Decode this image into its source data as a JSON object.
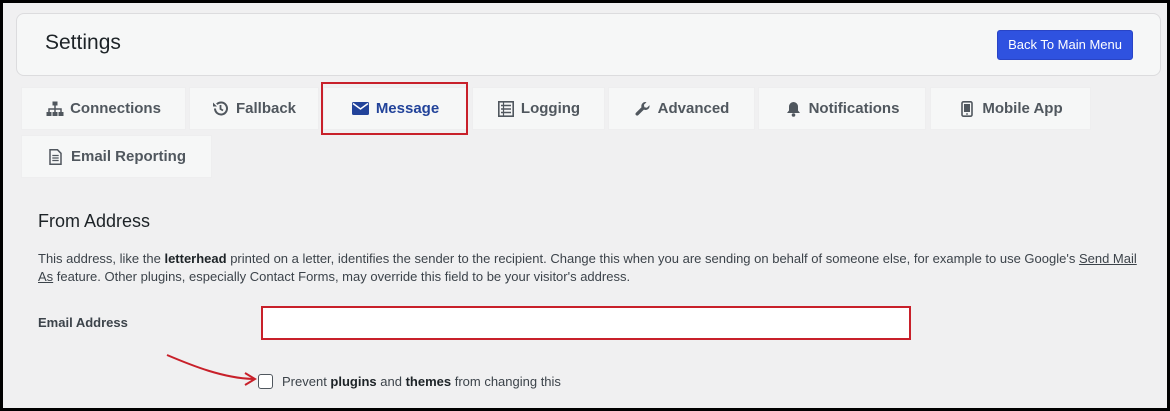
{
  "header": {
    "title": "Settings",
    "back_button": "Back To Main Menu"
  },
  "tabs": [
    {
      "label": "Connections",
      "icon": "sitemap-icon"
    },
    {
      "label": "Fallback",
      "icon": "history-icon"
    },
    {
      "label": "Message",
      "icon": "envelope-icon",
      "active": true
    },
    {
      "label": "Logging",
      "icon": "list-icon"
    },
    {
      "label": "Advanced",
      "icon": "wrench-icon"
    },
    {
      "label": "Notifications",
      "icon": "bell-icon"
    },
    {
      "label": "Mobile App",
      "icon": "mobile-icon"
    },
    {
      "label": "Email Reporting",
      "icon": "document-icon"
    }
  ],
  "from_address": {
    "title": "From Address",
    "desc_1": "This address, like the ",
    "desc_bold": "letterhead",
    "desc_2": " printed on a letter, identifies the sender to the recipient. Change this when you are sending on behalf of someone else, for example to use Google's ",
    "desc_link": "Send Mail As",
    "desc_3": " feature. Other plugins, especially Contact Forms, may override this field to be your visitor's address.",
    "email_label": "Email Address",
    "email_value": "",
    "prevent_1": "Prevent ",
    "prevent_bold_1": "plugins",
    "prevent_2": " and ",
    "prevent_bold_2": "themes",
    "prevent_3": " from changing this",
    "prevent_checked": false
  },
  "colors": {
    "accent": "#2f52e0",
    "active_tab": "#22439a",
    "highlight": "#c8202a"
  }
}
